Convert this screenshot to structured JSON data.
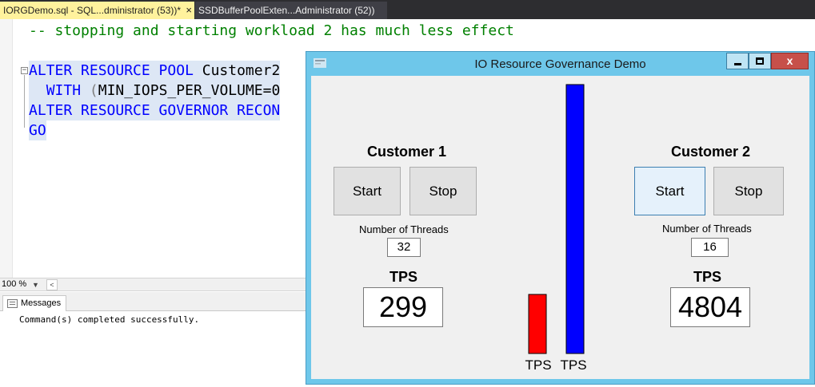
{
  "editor": {
    "tabs": [
      {
        "label": "IORGDemo.sql - SQL...dministrator (53))*",
        "close": "×"
      },
      {
        "label": "SSDBufferPoolExten...Administrator (52))"
      }
    ],
    "line1": "-- stopping and starting workload 2 has much less effect",
    "line2": {
      "kw": "ALTER RESOURCE POOL",
      "rest": " Customer2"
    },
    "line3": {
      "kw": "WITH",
      "paren": " (",
      "rest": "MIN_IOPS_PER_VOLUME=0"
    },
    "line4": {
      "kw": "ALTER RESOURCE GOVERNOR RECON"
    },
    "line5": {
      "kw": "GO"
    },
    "collapse_glyph": "−",
    "zoom": "100 %",
    "results_tab": "Messages",
    "message": "Command(s) completed successfully."
  },
  "demo": {
    "title": "IO Resource Governance Demo",
    "controls": {
      "close": "x"
    },
    "customer1": {
      "title": "Customer 1",
      "start_label": "Start",
      "stop_label": "Stop",
      "threads_label": "Number of Threads",
      "threads": "32",
      "tps_label": "TPS",
      "tps": "299"
    },
    "customer2": {
      "title": "Customer 2",
      "start_label": "Start",
      "stop_label": "Stop",
      "threads_label": "Number of Threads",
      "threads": "16",
      "tps_label": "TPS",
      "tps": "4804"
    },
    "colors": {
      "customer1_bar": "#ff0000",
      "customer2_bar": "#0000ff"
    }
  },
  "chart_data": {
    "type": "bar",
    "categories": [
      "TPS",
      "TPS"
    ],
    "values": [
      299,
      4804
    ],
    "ylim": [
      0,
      4804
    ],
    "colors": [
      "#ff0000",
      "#0000ff"
    ],
    "grid": false
  }
}
